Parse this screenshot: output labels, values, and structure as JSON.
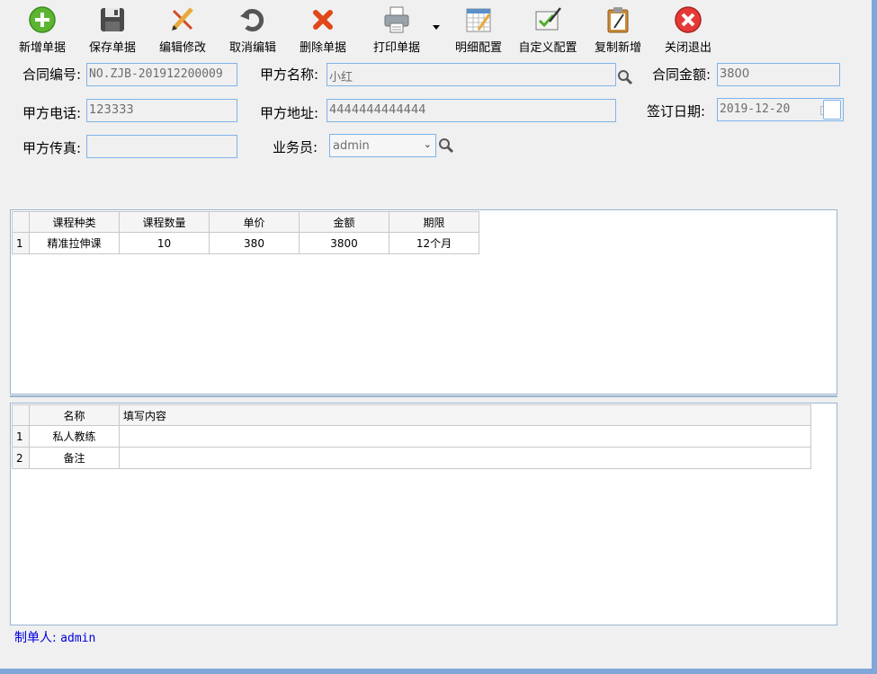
{
  "toolbar": {
    "buttons": [
      {
        "label": "新增单据",
        "icon": "add-icon"
      },
      {
        "label": "保存单据",
        "icon": "save-icon"
      },
      {
        "label": "编辑修改",
        "icon": "edit-icon"
      },
      {
        "label": "取消编辑",
        "icon": "undo-icon"
      },
      {
        "label": "删除单据",
        "icon": "delete-icon"
      },
      {
        "label": "打印单据",
        "icon": "print-icon"
      },
      {
        "label": "明细配置",
        "icon": "calendar-config-icon"
      },
      {
        "label": "自定义配置",
        "icon": "custom-config-icon"
      },
      {
        "label": "复制新增",
        "icon": "copy-icon"
      },
      {
        "label": "关闭退出",
        "icon": "close-icon"
      }
    ]
  },
  "form": {
    "contract_no": {
      "label": "合同编号:",
      "value": "NO.ZJB-201912200009"
    },
    "party_a_name": {
      "label": "甲方名称:",
      "value": "小红"
    },
    "contract_amount": {
      "label": "合同金额:",
      "value": "3800"
    },
    "party_a_phone": {
      "label": "甲方电话:",
      "value": "123333"
    },
    "party_a_address": {
      "label": "甲方地址:",
      "value": "4444444444444"
    },
    "sign_date": {
      "label": "签订日期:",
      "value": "2019-12-20"
    },
    "party_a_fax": {
      "label": "甲方传真:",
      "value": ""
    },
    "salesperson": {
      "label": "业务员:",
      "value": "admin"
    }
  },
  "course_grid": {
    "headers": [
      "课程种类",
      "课程数量",
      "单价",
      "金额",
      "期限"
    ],
    "rows": [
      {
        "num": "1",
        "cells": [
          "精准拉伸课",
          "10",
          "380",
          "3800",
          "12个月"
        ]
      }
    ]
  },
  "custom_grid": {
    "headers": [
      "名称",
      "填写内容"
    ],
    "rows": [
      {
        "num": "1",
        "cells": [
          "私人教练",
          ""
        ]
      },
      {
        "num": "2",
        "cells": [
          "备注",
          ""
        ]
      }
    ]
  },
  "footer": {
    "maker_label": "制单人:",
    "maker_value": "admin"
  },
  "colors": {
    "field_border": "#7eb4ea",
    "window_edge": "#7fa7d9",
    "maker_text": "#0000e0"
  }
}
